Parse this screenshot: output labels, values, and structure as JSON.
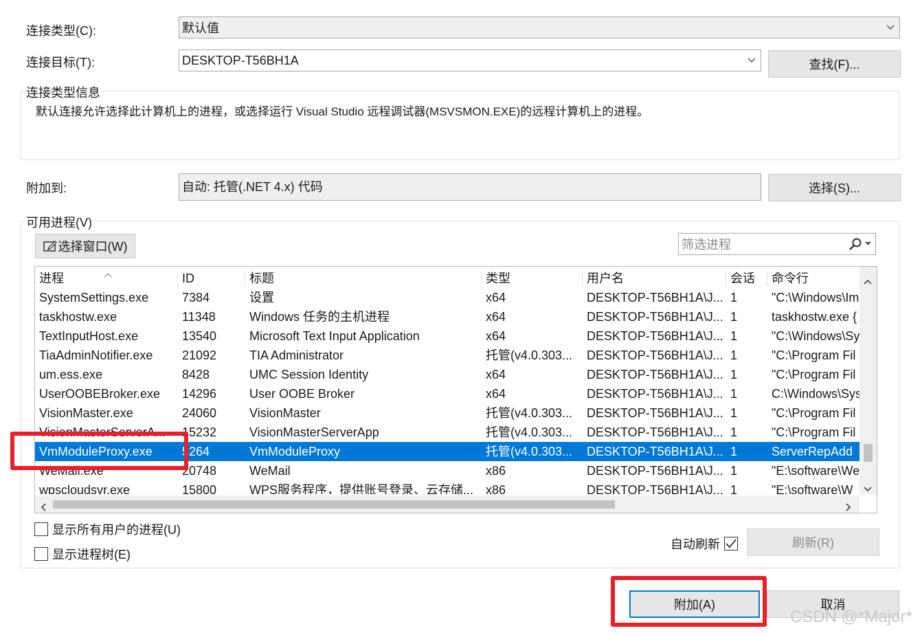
{
  "connection": {
    "type_label": "连接类型(C):",
    "type_value": "默认值",
    "target_label": "连接目标(T):",
    "target_value": "DESKTOP-T56BH1A",
    "find_button": "查找(F)...",
    "info_legend": "连接类型信息",
    "info_text": "默认连接允许选择此计算机上的进程，或选择运行 Visual Studio 远程调试器(MSVSMON.EXE)的远程计算机上的进程。"
  },
  "attach_to": {
    "label": "附加到:",
    "value": "自动: 托管(.NET 4.x) 代码",
    "select_button": "选择(S)..."
  },
  "processes": {
    "legend": "可用进程(V)",
    "select_window_button": "选择窗口(W)",
    "filter_placeholder": "筛选进程",
    "columns": [
      "进程",
      "ID",
      "标题",
      "类型",
      "用户名",
      "会话",
      "命令行"
    ],
    "rows": [
      [
        "SystemSettings.exe",
        "7384",
        "设置",
        "x64",
        "DESKTOP-T56BH1A\\J...",
        "1",
        "\"C:\\Windows\\Im"
      ],
      [
        "taskhostw.exe",
        "11348",
        "Windows 任务的主机进程",
        "x64",
        "DESKTOP-T56BH1A\\J...",
        "1",
        "taskhostw.exe {"
      ],
      [
        "TextInputHost.exe",
        "13540",
        "Microsoft Text Input Application",
        "x64",
        "DESKTOP-T56BH1A\\J...",
        "1",
        "\"C:\\Windows\\Sy"
      ],
      [
        "TiaAdminNotifier.exe",
        "21092",
        "TIA Administrator",
        "托管(v4.0.303...",
        "DESKTOP-T56BH1A\\J...",
        "1",
        "\"C:\\Program Fil"
      ],
      [
        "um.ess.exe",
        "8428",
        "UMC Session Identity",
        "x64",
        "DESKTOP-T56BH1A\\J...",
        "1",
        "\"C:\\Program Fil"
      ],
      [
        "UserOOBEBroker.exe",
        "14296",
        "User OOBE Broker",
        "x64",
        "DESKTOP-T56BH1A\\J...",
        "1",
        "C:\\Windows\\Sys"
      ],
      [
        "VisionMaster.exe",
        "24060",
        "VisionMaster",
        "托管(v4.0.303...",
        "DESKTOP-T56BH1A\\J...",
        "1",
        "\"C:\\Program Fil"
      ],
      [
        "VisionMasterServerA...",
        "15232",
        "VisionMasterServerApp",
        "托管(v4.0.303...",
        "DESKTOP-T56BH1A\\J...",
        "1",
        "\"C:\\Program Fil"
      ],
      [
        "VmModuleProxy.exe",
        "5264",
        "VmModuleProxy",
        "托管(v4.0.303...",
        "DESKTOP-T56BH1A\\J...",
        "1",
        "ServerRepAdd"
      ],
      [
        "WeMail.exe",
        "20748",
        "WeMail",
        "x86",
        "DESKTOP-T56BH1A\\J...",
        "1",
        "\"E:\\software\\We"
      ],
      [
        "wpscloudsvr.exe",
        "15800",
        "WPS服务程序，提供账号登录、云存储...",
        "x86",
        "DESKTOP-T56BH1A\\J...",
        "1",
        "\"E:\\software\\W"
      ]
    ],
    "selected_row": 8,
    "show_all_users": "显示所有用户的进程(U)",
    "show_tree": "显示进程树(E)",
    "auto_refresh": "自动刷新",
    "refresh_button": "刷新(R)"
  },
  "footer": {
    "attach_button": "附加(A)",
    "cancel_button": "取消",
    "watermark": "CSDN @*Major*"
  },
  "colors": {
    "selection": "#0078d7",
    "highlight": "#e8202a"
  }
}
